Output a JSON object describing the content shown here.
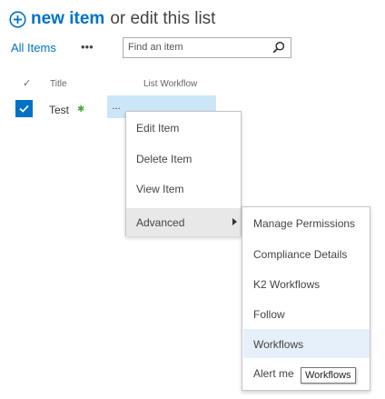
{
  "header": {
    "new_item": "new item",
    "or_edit": "or edit this list"
  },
  "toolbar": {
    "view_label": "All Items",
    "more": "•••",
    "search_placeholder": "Find an item"
  },
  "list": {
    "columns": {
      "check": "✓",
      "title": "Title",
      "workflow": "List Workflow"
    },
    "rows": [
      {
        "title": "Test",
        "new_badge": "✱",
        "selected": true,
        "ellipsis": "..."
      }
    ]
  },
  "callout_menu": {
    "items": [
      "Edit Item",
      "Delete Item",
      "View Item"
    ],
    "advanced": "Advanced"
  },
  "advanced_menu": {
    "items": [
      "Manage Permissions",
      "Compliance Details",
      "K2 Workflows",
      "Follow",
      "Workflows",
      "Alert me"
    ],
    "highlighted": "Workflows"
  },
  "tooltip": "Workflows",
  "colors": {
    "accent": "#0072c6",
    "selection": "#cde6f7",
    "hover": "#e5f0fb",
    "new_badge": "#4caa3d"
  }
}
